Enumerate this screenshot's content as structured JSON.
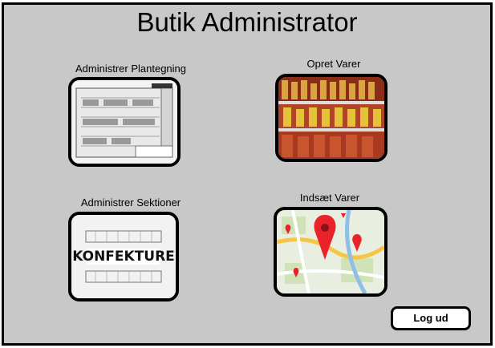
{
  "window": {
    "title": "Butik Administrator"
  },
  "tiles": [
    {
      "label": "Administrer Plantegning",
      "icon": "floor-plan-image"
    },
    {
      "label": "Opret Varer",
      "icon": "grocery-shelf-image"
    },
    {
      "label": "Administrer Sektioner",
      "icon": "section-plan-image",
      "image_text": "KONFEKTURE"
    },
    {
      "label": "Indsæt Varer",
      "icon": "map-pin-image"
    }
  ],
  "logout_label": "Log ud",
  "colors": {
    "background": "#c8c8c8",
    "border": "#000000",
    "pin": "#e8232a"
  }
}
